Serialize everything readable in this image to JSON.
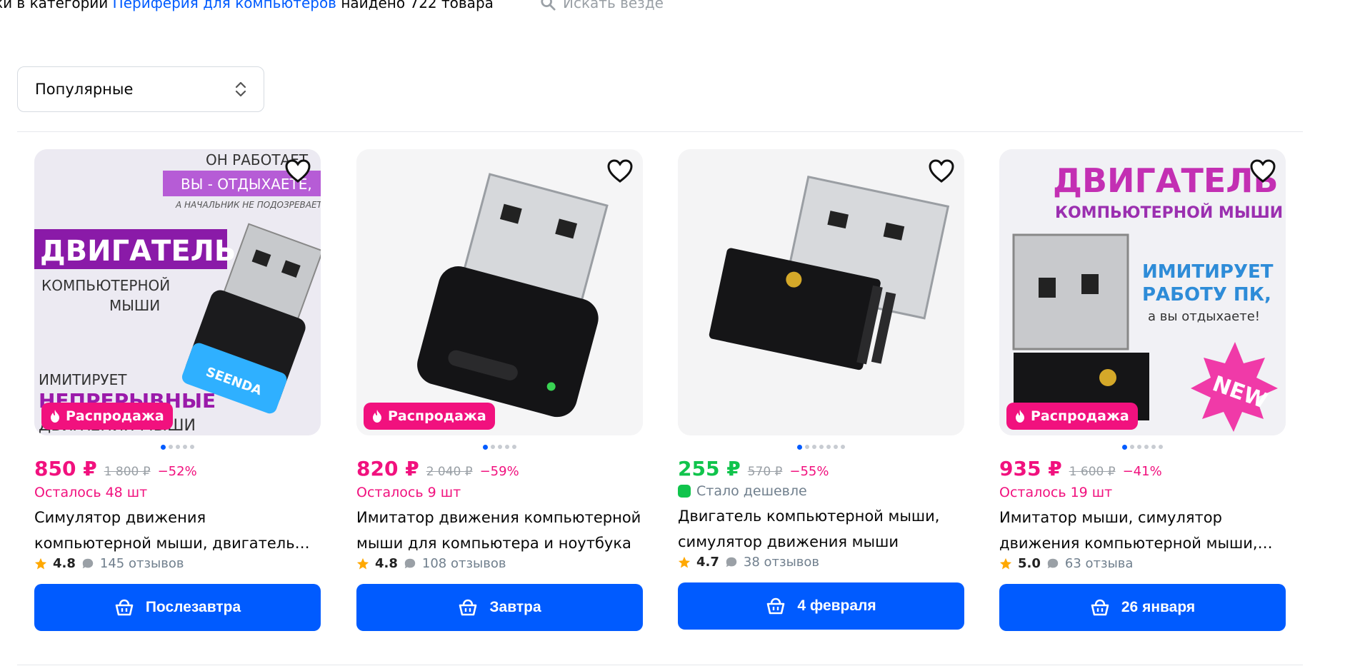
{
  "header": {
    "prefix": "ки в категории",
    "category_link": "Периферия для компьютеров",
    "suffix": "найдено 722 товара",
    "search_everywhere": "Искать везде"
  },
  "sort": {
    "selected": "Популярные"
  },
  "colors": {
    "accent": "#005bff",
    "sale": "#f1117e",
    "green": "#10c44c"
  },
  "products": [
    {
      "price": "850 ₽",
      "old_price": "1 800 ₽",
      "discount": "−52%",
      "stock": "Осталось 48 шт",
      "title": "Симулятор движения компьютерной мыши, двигатель…",
      "rating": "4.8",
      "reviews": "145 отзывов",
      "delivery": "Послезавтра",
      "sale_label": "Распродажа",
      "image_text": {
        "line1": "ОН РАБОТАЕТ",
        "line2": "ВЫ - ОТДЫХАЕТЕ,",
        "line3": "А НАЧАЛЬНИК НЕ ПОДОЗРЕВАЕТ!",
        "big": "ДВИГАТЕЛЬ",
        "sub1": "КОМПЬЮТЕРНОЙ",
        "sub2": "МЫШИ",
        "bottom1": "ИМИТИРУЕТ",
        "bottom2": "НЕПРЕРЫВНЫЕ",
        "bottom3": "ДВИЖЕНИЯ МЫШИ",
        "brand": "SEENDA"
      },
      "dots_total": 5,
      "dot_active": 1
    },
    {
      "price": "820 ₽",
      "old_price": "2 040 ₽",
      "discount": "−59%",
      "stock": "Осталось 9 шт",
      "title": "Имитатор движения компьютерной мыши для компьютера и ноутбука",
      "rating": "4.8",
      "reviews": "108 отзывов",
      "delivery": "Завтра",
      "sale_label": "Распродажа",
      "dots_total": 5,
      "dot_active": 1
    },
    {
      "price": "255 ₽",
      "old_price": "570 ₽",
      "discount": "−55%",
      "cheaper": "Стало дешевле",
      "title": "Двигатель компьютерной мыши, симулятор движения мыши",
      "rating": "4.7",
      "reviews": "38 отзывов",
      "delivery": "4 февраля",
      "dots_total": 7,
      "dot_active": 1
    },
    {
      "price": "935 ₽",
      "old_price": "1 600 ₽",
      "discount": "−41%",
      "stock": "Осталось 19 шт",
      "title": "Имитатор мыши, симулятор движения компьютерной мыши,…",
      "rating": "5.0",
      "reviews": "63 отзыва",
      "delivery": "26 января",
      "sale_label": "Распродажа",
      "image_text": {
        "big": "ДВИГАТЕЛЬ",
        "sub": "КОМПЬЮТЕРНОЙ МЫШИ",
        "right1": "ИМИТИРУЕТ",
        "right2": "РАБОТУ ПК,",
        "right3": "а вы отдыхаете!",
        "new": "NEW"
      },
      "dots_total": 6,
      "dot_active": 1
    }
  ]
}
